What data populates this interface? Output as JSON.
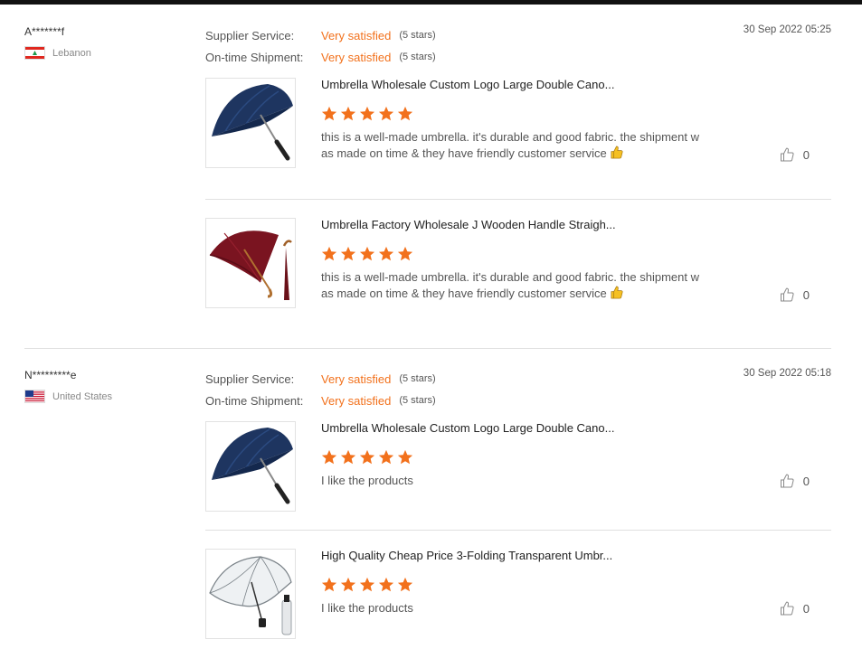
{
  "reviews": [
    {
      "user": {
        "name": "A*******f",
        "country": "Lebanon"
      },
      "supplier_service": {
        "label": "Supplier Service:",
        "value": "Very satisfied",
        "stars": "(5 stars)"
      },
      "shipment": {
        "label": "On-time Shipment:",
        "value": "Very satisfied",
        "stars": "(5 stars)"
      },
      "date": "30 Sep 2022 05:25",
      "products": [
        {
          "title": "Umbrella Wholesale Custom Logo Large Double Cano...",
          "rating": 5,
          "comment_line1": "this is a well-made umbrella. it's durable and good fabric. the shipment w",
          "comment_line2": "as made on time & they have friendly customer service",
          "likes": "0",
          "image_icon": "navy-golf-umbrella"
        },
        {
          "title": "Umbrella Factory Wholesale J Wooden Handle Straigh...",
          "rating": 5,
          "comment_line1": "this is a well-made umbrella. it's durable and good fabric. the shipment w",
          "comment_line2": "as made on time & they have friendly customer service",
          "likes": "0",
          "image_icon": "maroon-wooden-handle-umbrella"
        }
      ]
    },
    {
      "user": {
        "name": "N*********e",
        "country": "United States"
      },
      "supplier_service": {
        "label": "Supplier Service:",
        "value": "Very satisfied",
        "stars": "(5 stars)"
      },
      "shipment": {
        "label": "On-time Shipment:",
        "value": "Very satisfied",
        "stars": "(5 stars)"
      },
      "date": "30 Sep 2022 05:18",
      "products": [
        {
          "title": "Umbrella Wholesale Custom Logo Large Double Cano...",
          "rating": 5,
          "comment_line1": "I like the products",
          "likes": "0",
          "image_icon": "navy-golf-umbrella"
        },
        {
          "title": "High Quality Cheap Price 3-Folding Transparent Umbr...",
          "rating": 5,
          "comment_line1": "I like the products",
          "likes": "0",
          "image_icon": "transparent-folding-umbrella"
        }
      ]
    }
  ],
  "colors": {
    "accent": "#f2711c",
    "divider": "#e0e0e0"
  }
}
